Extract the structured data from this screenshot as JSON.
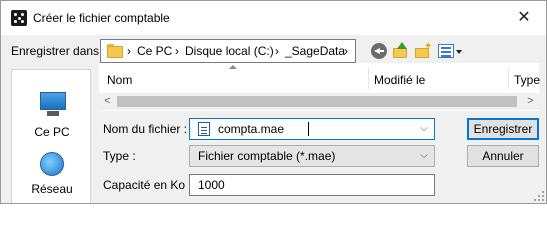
{
  "window": {
    "title": "Créer le fichier comptable",
    "close_glyph": "✕"
  },
  "toolbar": {
    "look_in_label": "Enregistrer dans :",
    "breadcrumb": [
      "›",
      "Ce PC",
      "›",
      "Disque local (C:)",
      "›",
      "_SageData",
      "›"
    ]
  },
  "places": [
    {
      "label": "Ce PC",
      "icon": "pc-icon"
    },
    {
      "label": "Réseau",
      "icon": "network-icon"
    }
  ],
  "file_list": {
    "columns": [
      "Nom",
      "Modifié le",
      "Type"
    ],
    "scroll_left": "<",
    "scroll_right": ">"
  },
  "form": {
    "filename_label": "Nom du fichier :",
    "filename_value": "compta.mae",
    "type_label": "Type :",
    "type_value": "Fichier comptable (*.mae)",
    "capacity_label": "Capacité en Ko :",
    "capacity_value": "1000",
    "dropdown_glyph": "⌵"
  },
  "buttons": {
    "save": "Enregistrer",
    "cancel": "Annuler"
  }
}
